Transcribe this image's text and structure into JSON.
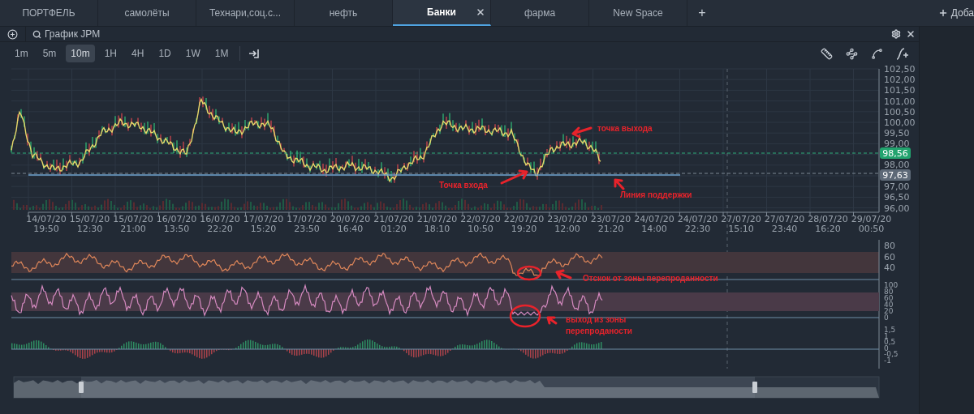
{
  "tabs": [
    {
      "label": "ПОРТФЕЛЬ",
      "selected": false,
      "closable": false
    },
    {
      "label": "самолёты",
      "selected": false,
      "closable": false
    },
    {
      "label": "Технари,соц.с...",
      "selected": false,
      "closable": false
    },
    {
      "label": "нефть",
      "selected": false,
      "closable": false
    },
    {
      "label": "Банки",
      "selected": true,
      "closable": true
    },
    {
      "label": "фарма",
      "selected": false,
      "closable": false
    },
    {
      "label": "New Space",
      "selected": false,
      "closable": false
    }
  ],
  "add_tab": "+",
  "add_button": "Доба",
  "chart": {
    "title": "График JPM",
    "intervals": [
      {
        "label": "1m",
        "selected": false
      },
      {
        "label": "5m",
        "selected": false
      },
      {
        "label": "10m",
        "selected": true
      },
      {
        "label": "1H",
        "selected": false
      },
      {
        "label": "4H",
        "selected": false
      },
      {
        "label": "1D",
        "selected": false
      },
      {
        "label": "1W",
        "selected": false
      },
      {
        "label": "1M",
        "selected": false
      }
    ],
    "price_axis_upper": [
      "102,50",
      "102,00",
      "101,50",
      "101,00",
      "100,50",
      "100,00",
      "99,50",
      "99,00"
    ],
    "price_axis_middle": [
      "98,00"
    ],
    "price_axis_lower": [
      "97,00",
      "96,50",
      "96,00"
    ],
    "price_badges": [
      {
        "text": "98,56",
        "kind": "last"
      },
      {
        "text": "97,63",
        "kind": "level"
      }
    ],
    "time_axis": [
      {
        "date": "14/07/20",
        "time": "19:50"
      },
      {
        "date": "15/07/20",
        "time": "12:30"
      },
      {
        "date": "15/07/20",
        "time": "21:00"
      },
      {
        "date": "16/07/20",
        "time": "13:50"
      },
      {
        "date": "16/07/20",
        "time": "22:20"
      },
      {
        "date": "17/07/20",
        "time": "15:20"
      },
      {
        "date": "17/07/20",
        "time": "23:50"
      },
      {
        "date": "20/07/20",
        "time": "16:40"
      },
      {
        "date": "21/07/20",
        "time": "01:20"
      },
      {
        "date": "21/07/20",
        "time": "18:10"
      },
      {
        "date": "22/07/20",
        "time": "10:50"
      },
      {
        "date": "22/07/20",
        "time": "19:20"
      },
      {
        "date": "23/07/20",
        "time": "12:00"
      },
      {
        "date": "23/07/20",
        "time": "21:20"
      },
      {
        "date": "24/07/20",
        "time": "14:00"
      },
      {
        "date": "24/07/20",
        "time": "22:30"
      },
      {
        "date": "27/07/20",
        "time": "15:10"
      },
      {
        "date": "27/07/20",
        "time": "23:40"
      },
      {
        "date": "28/07/20",
        "time": "16:20"
      },
      {
        "date": "29/07/20",
        "time": "00:50"
      }
    ],
    "indicator_1_axis": [
      "80",
      "60",
      "40"
    ],
    "indicator_2_axis": [
      "100",
      "80",
      "60",
      "40",
      "20",
      "0"
    ],
    "indicator_3_axis": [
      "1,5",
      "1",
      "0,5",
      "0",
      "-0,5",
      "-1"
    ],
    "annotations": [
      {
        "text": "точка выхода",
        "kind": "exit"
      },
      {
        "text": "Точка входа",
        "kind": "entry"
      },
      {
        "text": "Линия поддержки",
        "kind": "support"
      },
      {
        "text": "Отскок от зоны перепроданности",
        "kind": "bounce"
      },
      {
        "text": "выход из зоны",
        "kind": "leave"
      },
      {
        "text": "перепроданости",
        "kind": "leave2"
      }
    ]
  }
}
